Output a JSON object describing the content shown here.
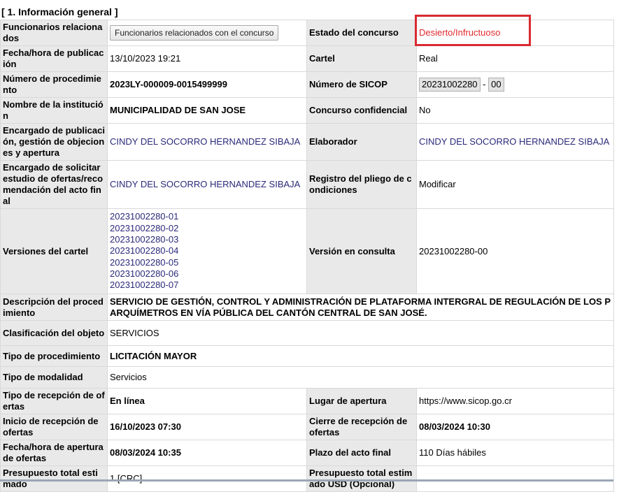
{
  "section": {
    "title": "[ 1. Información general ]"
  },
  "rows": {
    "funcionarios": {
      "label": "Funcionarios relacionados",
      "button": "Funcionarios relacionados con el concurso"
    },
    "estado": {
      "label": "Estado del concurso",
      "value": "Desierto/Infructuoso"
    },
    "fecha": {
      "label": "Fecha/hora de publicación",
      "value": "13/10/2023 19:21"
    },
    "cartel": {
      "label": "Cartel",
      "value": "Real"
    },
    "numero_proc": {
      "label": "Número de procedimiento",
      "value": "2023LY-000009-0015499999"
    },
    "numero_sicop": {
      "label": "Número de SICOP",
      "value": "20231002280",
      "separator": "-",
      "suffix": "00"
    },
    "institucion": {
      "label": "Nombre de la institución",
      "value": "MUNICIPALIDAD DE SAN JOSE"
    },
    "confidencial": {
      "label": "Concurso confidencial",
      "value": "No"
    },
    "encargado_pub": {
      "label": "Encargado de publicación, gestión de objeciones y apertura",
      "value": "CINDY DEL SOCORRO HERNANDEZ SIBAJA"
    },
    "elaborador": {
      "label": "Elaborador",
      "value": "CINDY DEL SOCORRO HERNANDEZ SIBAJA"
    },
    "encargado_est": {
      "label": "Encargado de solicitar estudio de ofertas/recomendación del acto final",
      "value": "CINDY DEL SOCORRO HERNANDEZ SIBAJA"
    },
    "registro": {
      "label": "Registro del pliego de condiciones",
      "value": "Modificar"
    },
    "versiones": {
      "label": "Versiones del cartel",
      "items": [
        "20231002280-01",
        "20231002280-02",
        "20231002280-03",
        "20231002280-04",
        "20231002280-05",
        "20231002280-06",
        "20231002280-07"
      ]
    },
    "version_consulta": {
      "label": "Versión en consulta",
      "value": "20231002280-00"
    },
    "descripcion": {
      "label": "Descripción del procedimiento",
      "value": "SERVICIO DE GESTIÓN, CONTROL Y ADMINISTRACIÓN DE PLATAFORMA INTERGRAL DE REGULACIÓN DE LOS PARQUÍMETROS EN VÍA PÚBLICA DEL CANTÓN CENTRAL DE SAN JOSÉ."
    },
    "clasificacion": {
      "label": "Clasificación del objeto",
      "value": "SERVICIOS"
    },
    "tipo_proc": {
      "label": "Tipo de procedimiento",
      "value": "LICITACIÓN MAYOR"
    },
    "modalidad": {
      "label": "Tipo de modalidad",
      "value": "Servicios"
    },
    "recepcion": {
      "label": "Tipo de recepción de ofertas",
      "value": "En línea"
    },
    "lugar": {
      "label": "Lugar de apertura",
      "value": "https://www.sicop.go.cr"
    },
    "inicio": {
      "label": "Inicio de recepción de ofertas",
      "value": "16/10/2023 07:30"
    },
    "cierre": {
      "label": "Cierre de recepción de ofertas",
      "value": "08/03/2024 10:30"
    },
    "apertura": {
      "label": "Fecha/hora de apertura de ofertas",
      "value": "08/03/2024 10:35"
    },
    "plazo": {
      "label": "Plazo del acto final",
      "value": "110 Días hábiles"
    },
    "presupuesto": {
      "label": "Presupuesto total estimado",
      "value": "1 [CRC]"
    },
    "presupuesto_usd": {
      "label": "Presupuesto total estimado USD (Opcional)",
      "value": ""
    }
  },
  "colors": {
    "status": "#e0282e",
    "highlight": "#d92a30",
    "label_bg": "#e9e9e9",
    "link": "#2a2a7a"
  }
}
